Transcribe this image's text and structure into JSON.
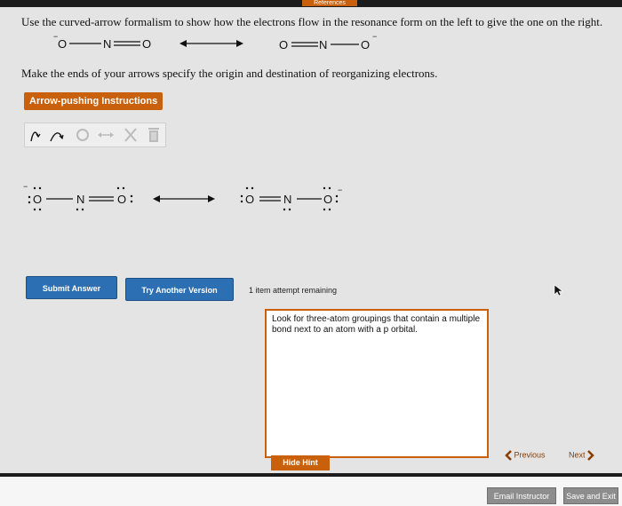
{
  "header": {
    "references_label": "References"
  },
  "question": {
    "prompt": "Use the curved-arrow formalism to show how the electrons flow in the resonance form on the left to give the one on the right.",
    "left_structure": {
      "o_left": "O",
      "n": "N",
      "o_right": "O",
      "charge": "−"
    },
    "right_structure": {
      "o_left": "O",
      "n": "N",
      "o_right": "O",
      "charge": "−"
    },
    "instructions": "Make the ends of your arrows specify the origin and destination of reorganizing electrons."
  },
  "toolbar": {
    "button_label": "Arrow-pushing Instructions",
    "tools": [
      "curved-arrow-double-icon",
      "curved-arrow-single-icon",
      "eraser-icon",
      "double-headed-arrow-icon",
      "close-icon",
      "trash-icon"
    ]
  },
  "canvas": {
    "left": {
      "o1": "O",
      "n": "N",
      "o2": "O",
      "charge": "−"
    },
    "right": {
      "o1": "O",
      "n": "N",
      "o2": "O",
      "charge": "−"
    }
  },
  "actions": {
    "submit_label": "Submit Answer",
    "try_another_label": "Try Another Version",
    "remaining_text": "1 item attempt remaining"
  },
  "hint": {
    "text": "Look for three-atom groupings that contain a multiple bond next to an atom with a p orbital.",
    "hide_label": "Hide Hint"
  },
  "nav": {
    "previous_label": "Previous",
    "next_label": "Next"
  },
  "footer": {
    "email_label": "Email Instructor",
    "save_label": "Save and Exit"
  },
  "colors": {
    "accent": "#c8600c",
    "primary_button": "#2d6fb3",
    "gray_button": "#8d8d8d"
  }
}
